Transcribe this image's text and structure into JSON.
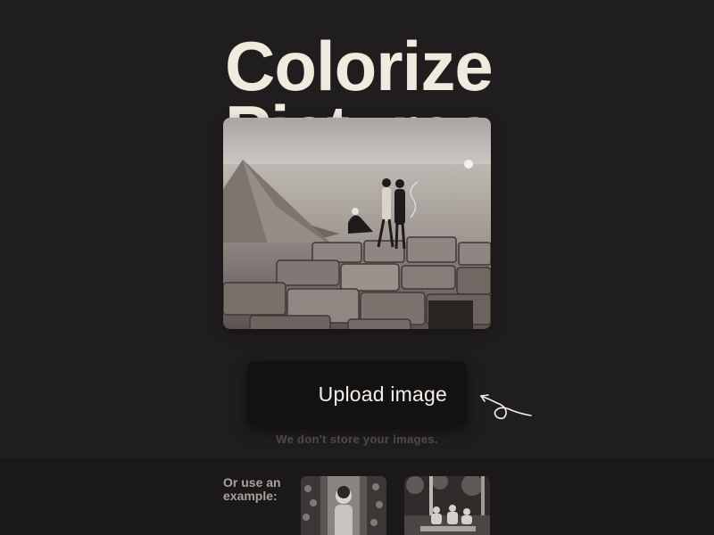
{
  "hero": {
    "title": "Colorize Pictures"
  },
  "upload": {
    "label": "Upload image"
  },
  "privacy_note": "We don't store your images.",
  "examples": {
    "label": "Or use an example:"
  },
  "colors": {
    "background": "#201d1e",
    "title": "#efebdf",
    "button_bg": "#131112",
    "button_text": "#f2efe8",
    "muted_text": "#4e4a4b",
    "panel_bg": "#1a1818"
  }
}
